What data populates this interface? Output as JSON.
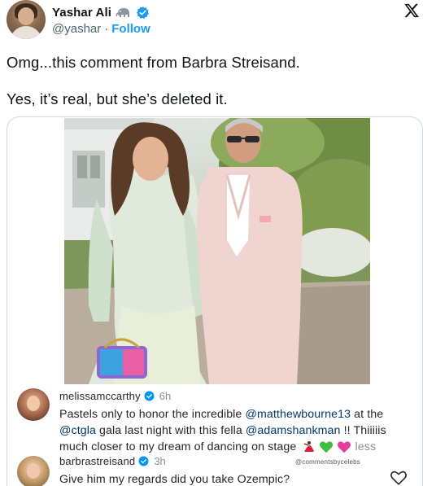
{
  "tweet": {
    "author": {
      "display_name": "Yashar Ali",
      "handle": "@yashar",
      "separator": "·",
      "follow_label": "Follow",
      "badge_icons": [
        "elephant-icon",
        "verified-icon"
      ]
    },
    "text_line_1": "Omg...this comment from Barbra Streisand.",
    "text_line_2": "Yes, it’s real, but she’s deleted it.",
    "platform_icon": "x-logo-icon"
  },
  "instagram_screenshot": {
    "photo_icon": "photo-two-people-pastel-suits",
    "comments": [
      {
        "user": "melissamccarthy",
        "time": "6h",
        "verified": true,
        "text_parts": [
          {
            "t": "Pastels only to honor the incredible ",
            "mention": false
          },
          {
            "t": "@matthewbourne13",
            "mention": true
          },
          {
            "t": " at the ",
            "mention": false
          },
          {
            "t": "@ctgla",
            "mention": true
          },
          {
            "t": " gala last night with this fella ",
            "mention": false
          },
          {
            "t": "@adamshankman",
            "mention": true
          },
          {
            "t": " !! Thiiiiis much closer to my dream of dancing on stage ",
            "mention": false
          }
        ],
        "emojis": [
          "dancer-emoji",
          "green-heart-emoji",
          "pink-heart-emoji"
        ],
        "more_label": "less"
      },
      {
        "user": "barbrastreisand",
        "time": "3h",
        "verified": true,
        "text": "Give him my regards did you take Ozempic?"
      }
    ],
    "watermark": "@commentsbycelebs",
    "like_icon": "heart-icon"
  },
  "colors": {
    "link_blue": "#1d9bf0",
    "verified_blue": "#1d9bf0",
    "text_dark": "#0f1419",
    "muted": "#536471",
    "ig_mention": "#00376b"
  }
}
